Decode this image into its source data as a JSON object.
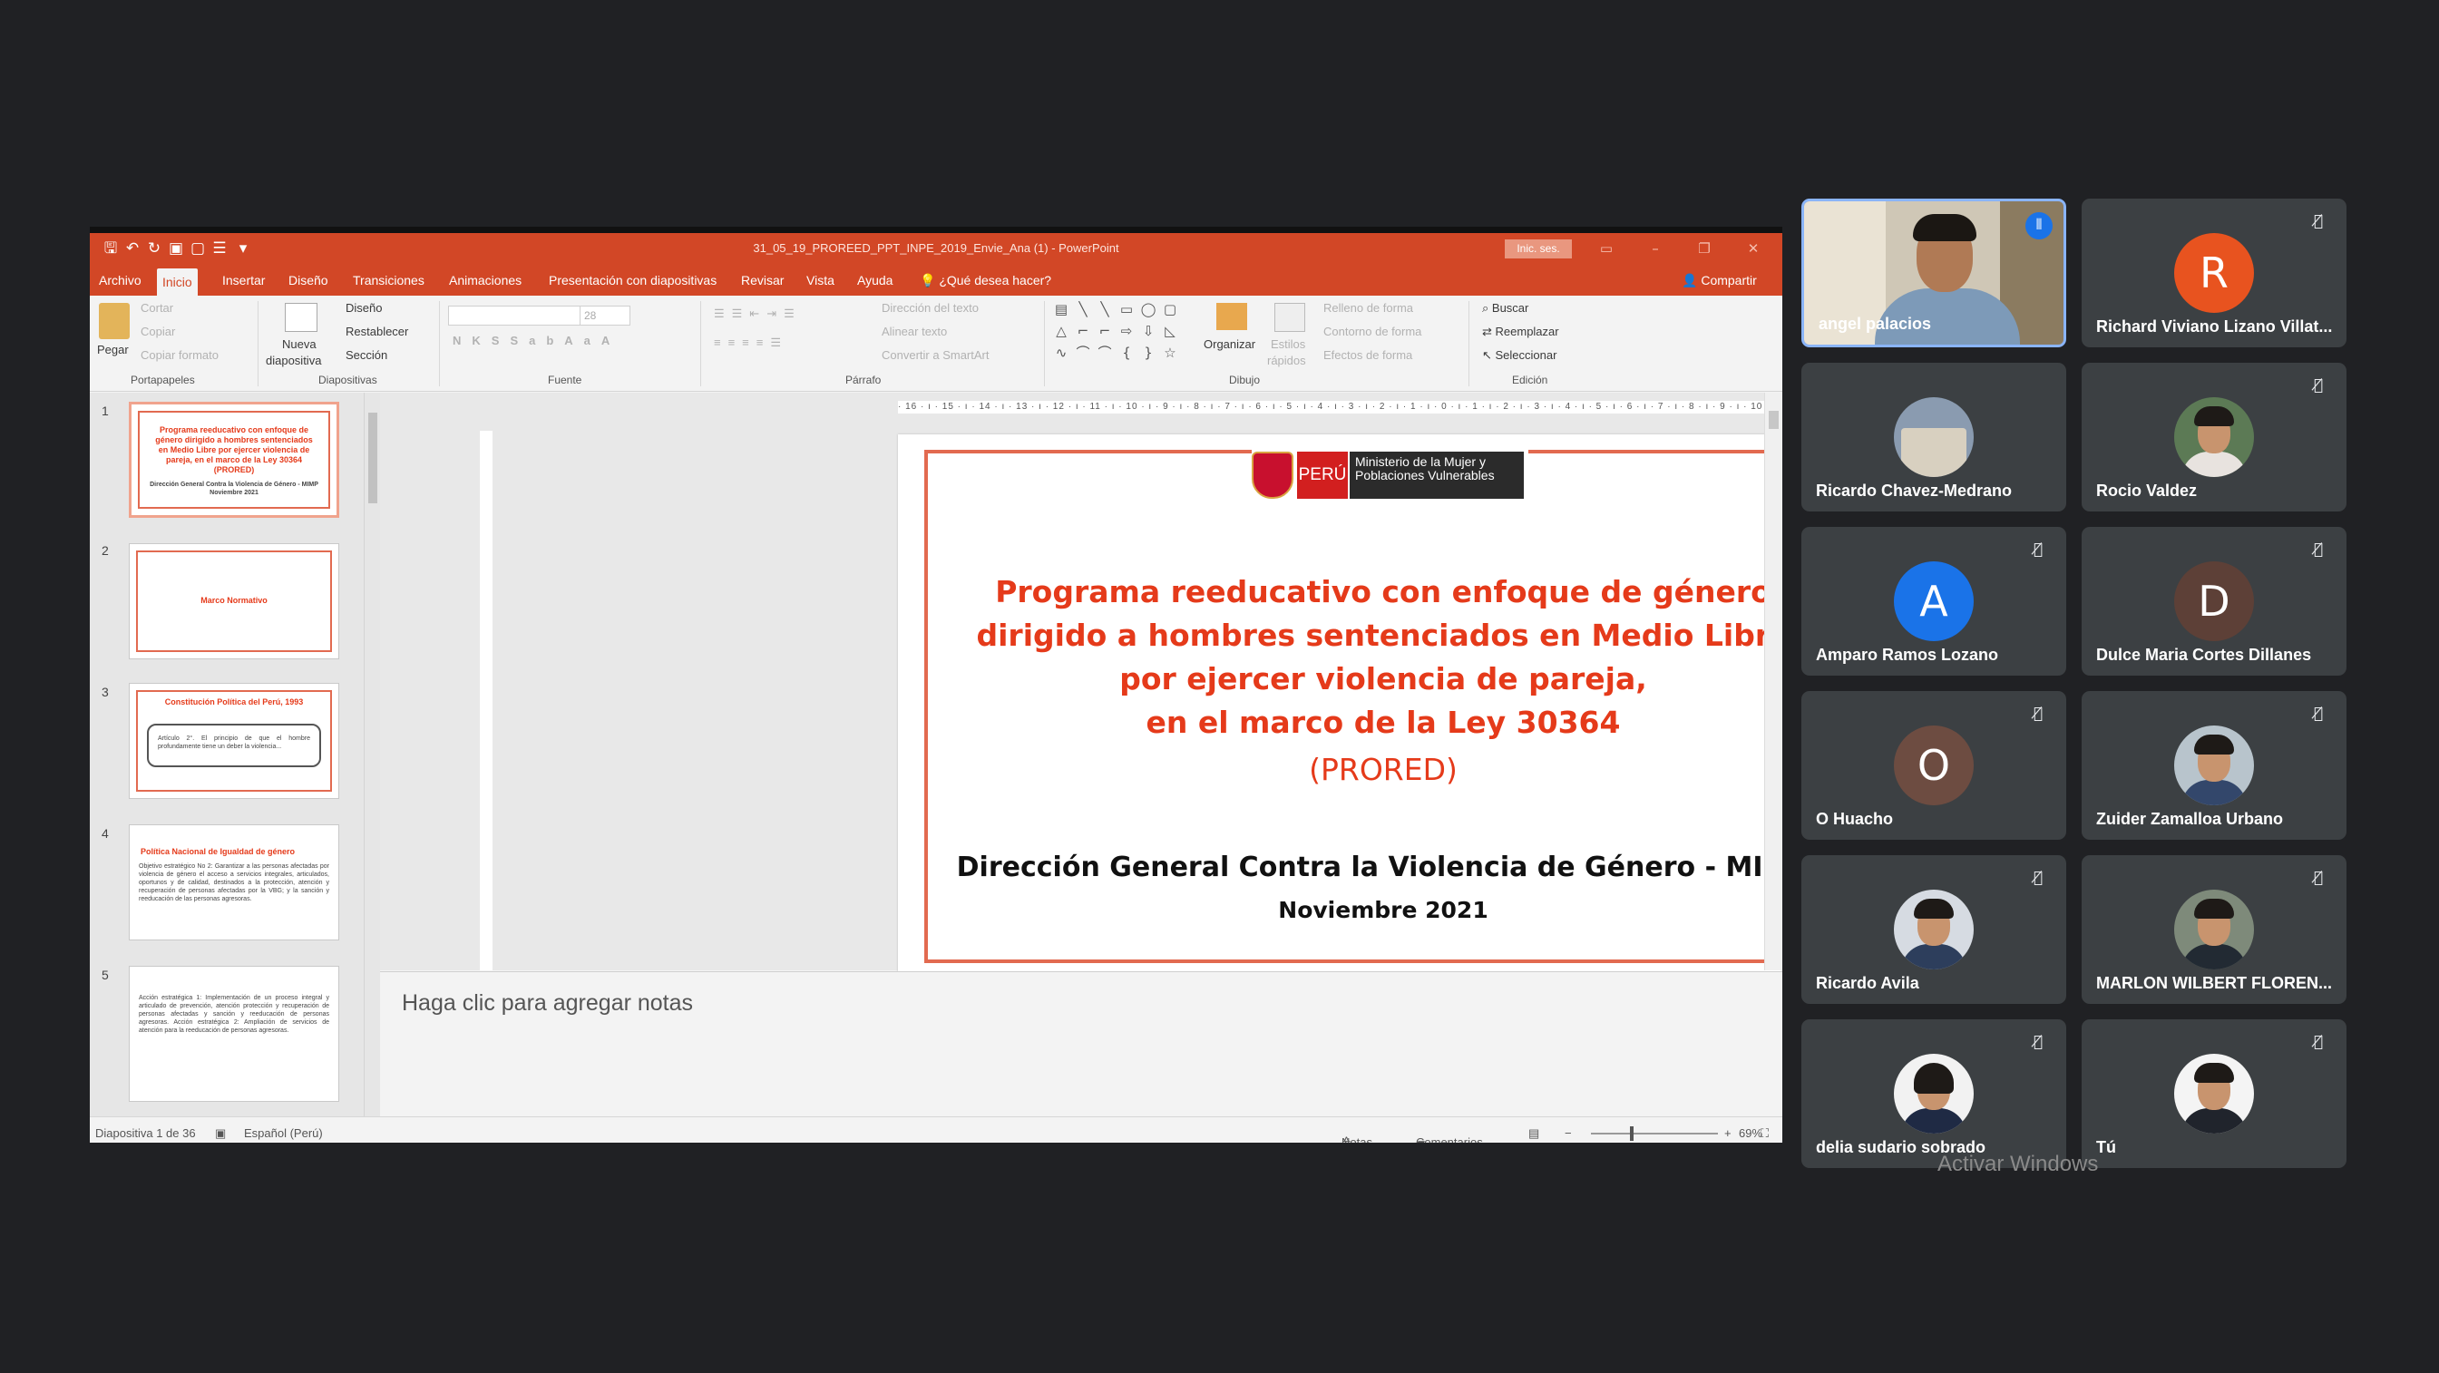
{
  "powerpoint": {
    "document_title": "31_05_19_PROREED_PPT_INPE_2019_Envie_Ana (1)  -  PowerPoint",
    "sign_in": "Inic. ses.",
    "tabs": [
      "Archivo",
      "Inicio",
      "Insertar",
      "Diseño",
      "Transiciones",
      "Animaciones",
      "Presentación con diapositivas",
      "Revisar",
      "Vista",
      "Ayuda"
    ],
    "tell_me": "¿Qué desea hacer?",
    "share": "Compartir",
    "ribbon": {
      "paste": "Pegar",
      "cut": "Cortar",
      "copy": "Copiar",
      "format_painter": "Copiar formato",
      "new_slide_1": "Nueva",
      "new_slide_2": "diapositiva",
      "layout": "Diseño",
      "reset": "Restablecer",
      "section": "Sección",
      "font_size": "28",
      "text_direction": "Dirección del texto",
      "align_text": "Alinear texto",
      "smartart": "Convertir a SmartArt",
      "arrange": "Organizar",
      "quick_styles_1": "Estilos",
      "quick_styles_2": "rápidos",
      "shape_fill": "Relleno de forma",
      "shape_outline": "Contorno de forma",
      "shape_effects": "Efectos de forma",
      "find": "Buscar",
      "replace": "Reemplazar",
      "select": "Seleccionar",
      "groups": [
        "Portapapeles",
        "Diapositivas",
        "Fuente",
        "Párrafo",
        "Dibujo",
        "Edición"
      ]
    },
    "thumbnails": [
      {
        "num": "1",
        "title": "Programa reeducativo con enfoque de género dirigido a hombres sentenciados en Medio Libre por ejercer violencia de pareja, en el marco de la Ley 30364 (PRORED)",
        "sub": "Dirección General Contra la Violencia de Género - MIMP  Noviembre 2021"
      },
      {
        "num": "2",
        "title": "Marco Normativo",
        "sub": ""
      },
      {
        "num": "3",
        "title": "Constitución Política del Perú, 1993",
        "sub": "Artículo 2°. El principio de que el hombre profundamente tiene un deber la violencia..."
      },
      {
        "num": "4",
        "title": "Política Nacional de Igualdad de género",
        "sub": "Objetivo estratégico No 2: Garantizar a las personas afectadas por violencia de género el acceso a servicios integrales, articulados, oportunos y de calidad, destinados a la protección, atención y recuperación de personas afectadas por la VBG; y la sanción y reeducación de las personas agresoras."
      },
      {
        "num": "5",
        "title": "",
        "sub": "Acción estratégica 1: Implementación de un proceso integral y articulado de prevención, atención protección y recuperación de personas afectadas y sanción y reeducación de personas agresoras.  Acción estratégica 2: Ampliación de servicios de atención para la reeducación de personas agresoras."
      }
    ],
    "slide": {
      "peru": "PERÚ",
      "ministry": "Ministerio de la Mujer y Poblaciones Vulnerables",
      "title_lines": [
        "Programa reeducativo con enfoque de género",
        "dirigido a hombres sentenciados en Medio Libre",
        "por ejercer violencia de pareja,",
        "en el marco de la Ley 30364"
      ],
      "acronym": "(PRORED)",
      "organization": "Dirección General Contra la Violencia de Género - MIMP",
      "date": "Noviembre 2021"
    },
    "notes_placeholder": "Haga clic para agregar notas",
    "status": {
      "slide_info": "Diapositiva 1 de 36",
      "language": "Español (Perú)",
      "notes": "Notas",
      "comments": "Comentarios",
      "zoom": "69%"
    }
  },
  "participants": [
    {
      "name": "angel palacios",
      "type": "video",
      "speaking": true,
      "muted": false
    },
    {
      "name": "Richard Viviano Lizano Villat...",
      "type": "initial",
      "initial": "R",
      "color": "#e8531f",
      "muted": true
    },
    {
      "name": "Ricardo Chavez-Medrano",
      "type": "photo",
      "muted": false
    },
    {
      "name": "Rocio Valdez",
      "type": "photo",
      "muted": true
    },
    {
      "name": "Amparo Ramos Lozano",
      "type": "initial",
      "initial": "A",
      "color": "#1a73e8",
      "muted": true
    },
    {
      "name": "Dulce Maria Cortes Dillanes",
      "type": "initial",
      "initial": "D",
      "color": "#5d4037",
      "muted": true
    },
    {
      "name": "O Huacho",
      "type": "initial",
      "initial": "O",
      "color": "#6d4c41",
      "muted": true
    },
    {
      "name": "Zuider Zamalloa Urbano",
      "type": "photo",
      "muted": true
    },
    {
      "name": "Ricardo Avila",
      "type": "photo",
      "muted": true
    },
    {
      "name": "MARLON WILBERT FLOREN...",
      "type": "photo",
      "muted": true
    },
    {
      "name": "delia sudario sobrado",
      "type": "photo",
      "muted": true
    },
    {
      "name": "Tú",
      "type": "photo",
      "muted": true
    }
  ],
  "watermark": "Activar Windows",
  "icons": [
    "save-icon",
    "undo-icon",
    "redo-icon",
    "present-icon",
    "lightbulb-icon",
    "user-icon",
    "mic-off-icon",
    "speaking-indicator-icon"
  ]
}
